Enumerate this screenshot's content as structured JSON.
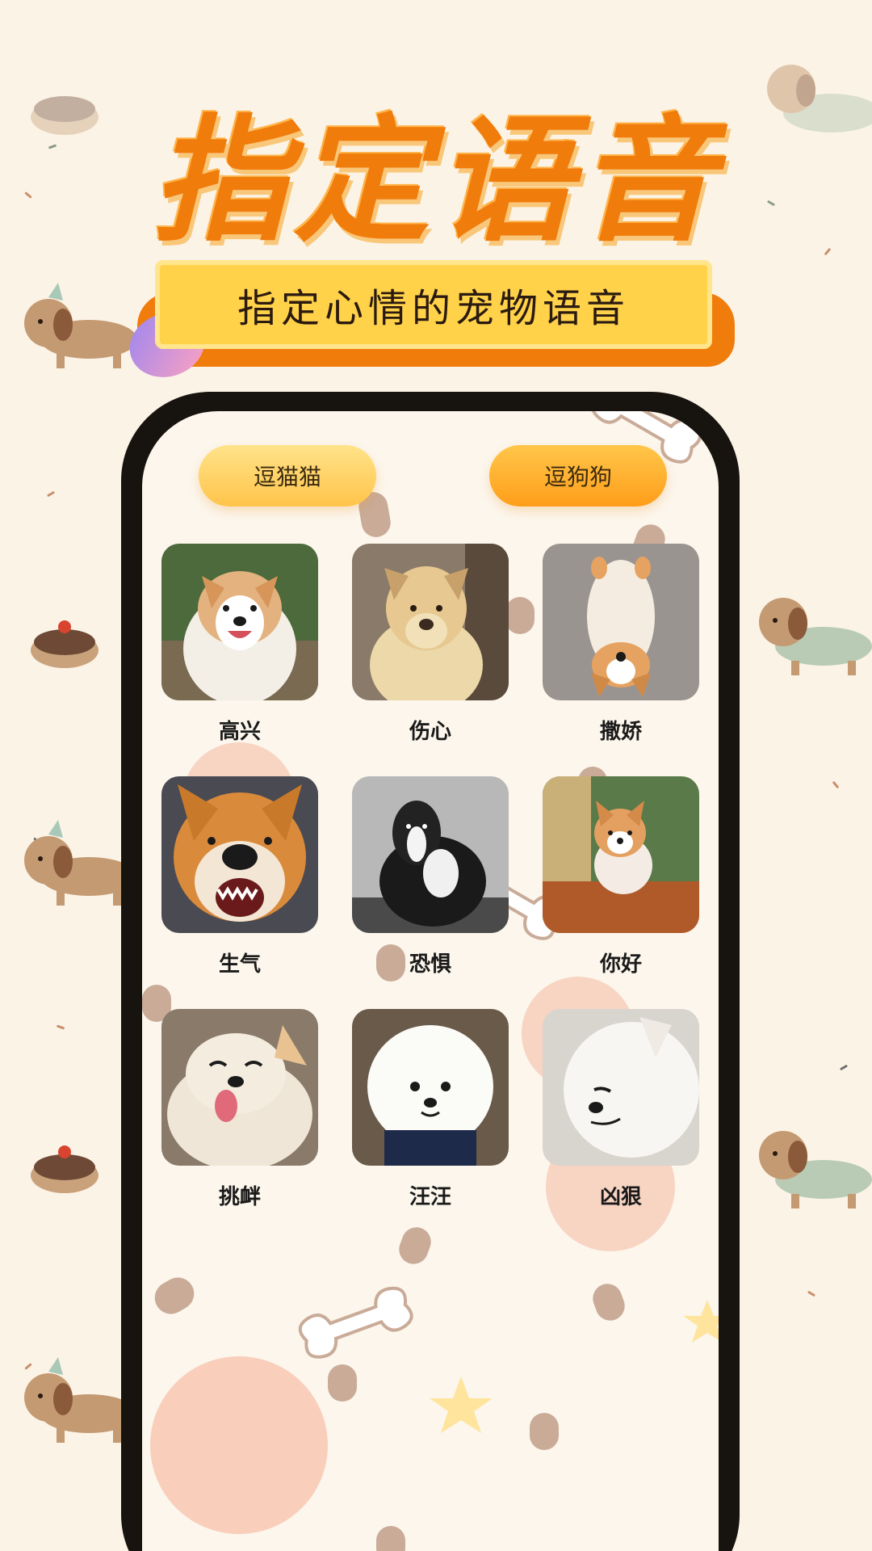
{
  "headline": "指定语音",
  "subtitle": "指定心情的宠物语音",
  "tabs": [
    {
      "label": "逗猫猫"
    },
    {
      "label": "逗狗狗"
    }
  ],
  "moods": [
    {
      "label": "高兴"
    },
    {
      "label": "伤心"
    },
    {
      "label": "撒娇"
    },
    {
      "label": "生气"
    },
    {
      "label": "恐惧"
    },
    {
      "label": "你好"
    },
    {
      "label": "挑衅"
    },
    {
      "label": "汪汪"
    },
    {
      "label": "凶狠"
    }
  ],
  "colors": {
    "accent": "#f07c0c",
    "background": "#fbf3e6",
    "subtitle_bg": "#ffd24a"
  }
}
